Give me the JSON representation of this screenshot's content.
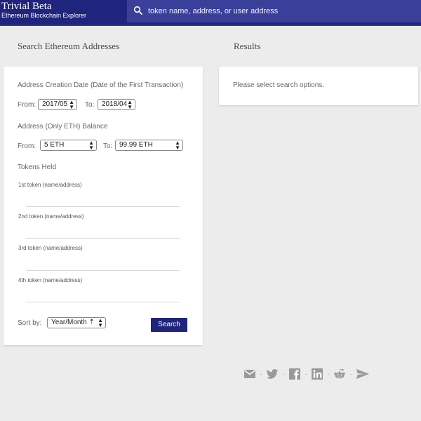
{
  "header": {
    "title": "Trivial Beta",
    "subtitle": "Ethereum Blockchain Explorer",
    "search_placeholder": "token name, address, or user address"
  },
  "left_panel": {
    "title": "Search Ethereum Addresses",
    "creation_date_label": "Address Creation Date (Date of the First Transaction)",
    "from_label": "From:",
    "to_label": "To:",
    "date_from_value": "2017/05",
    "date_to_value": "2018/04",
    "balance_label": "Address (Only ETH) Balance",
    "balance_from_label": "From:",
    "balance_to_label": "To:",
    "balance_from_value": "5 ETH",
    "balance_to_value": "99.99 ETH",
    "tokens_label": "Tokens Held",
    "token_fields": [
      "1st token (name/address)",
      "2nd token (name/address)",
      "3rd token (name/address)",
      "4th token (name/address)"
    ],
    "sort_label": "Sort by:",
    "sort_value": "Year/Month ⇡",
    "search_button": "Search"
  },
  "right_panel": {
    "title": "Results",
    "message": "Please select search options."
  },
  "social_icons": [
    "mail-icon",
    "twitter-icon",
    "facebook-icon",
    "linkedin-icon",
    "reddit-icon",
    "telegram-icon"
  ],
  "colors": {
    "brand": "#1f247c",
    "search_bg": "#3a3f99",
    "page_bg": "#ececec",
    "icon_gray": "#9a9a9a"
  }
}
